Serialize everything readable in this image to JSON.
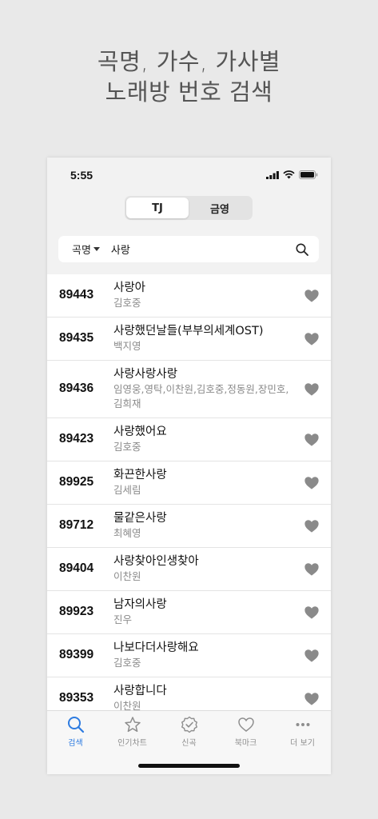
{
  "promo": {
    "line1": "곡명, 가수, 가사별",
    "line2": "노래방 번호 검색"
  },
  "status": {
    "time": "5:55"
  },
  "segment": {
    "options": [
      "TJ",
      "금영"
    ],
    "selected": "TJ"
  },
  "search": {
    "type": "곡명",
    "query": "사랑"
  },
  "results": [
    {
      "number": "89443",
      "title": "사랑아",
      "artist": "김호중"
    },
    {
      "number": "89435",
      "title": "사랑했던날들(부부의세계OST)",
      "artist": "백지영"
    },
    {
      "number": "89436",
      "title": "사랑사랑사랑",
      "artist": "임영웅,영탁,이찬원,김호중,정동원,장민호,김희재"
    },
    {
      "number": "89423",
      "title": "사랑했어요",
      "artist": "김호중"
    },
    {
      "number": "89925",
      "title": "화끈한사랑",
      "artist": "김세림"
    },
    {
      "number": "89712",
      "title": "물같은사랑",
      "artist": "최혜영"
    },
    {
      "number": "89404",
      "title": "사랑찾아인생찾아",
      "artist": "이찬원"
    },
    {
      "number": "89923",
      "title": "남자의사랑",
      "artist": "진우"
    },
    {
      "number": "89399",
      "title": "나보다더사랑해요",
      "artist": "김호중"
    },
    {
      "number": "89353",
      "title": "사랑합니다",
      "artist": "이찬원"
    }
  ],
  "tabs": [
    {
      "label": "검색",
      "icon": "search-icon",
      "active": true
    },
    {
      "label": "인기차트",
      "icon": "star-icon",
      "active": false
    },
    {
      "label": "신곡",
      "icon": "new-badge-icon",
      "active": false
    },
    {
      "label": "북마크",
      "icon": "heart-icon",
      "active": false
    },
    {
      "label": "더 보기",
      "icon": "more-icon",
      "active": false
    }
  ],
  "colors": {
    "accent": "#2d7be0",
    "heart": "#8a8a8a",
    "background": "#e9e9e9"
  }
}
